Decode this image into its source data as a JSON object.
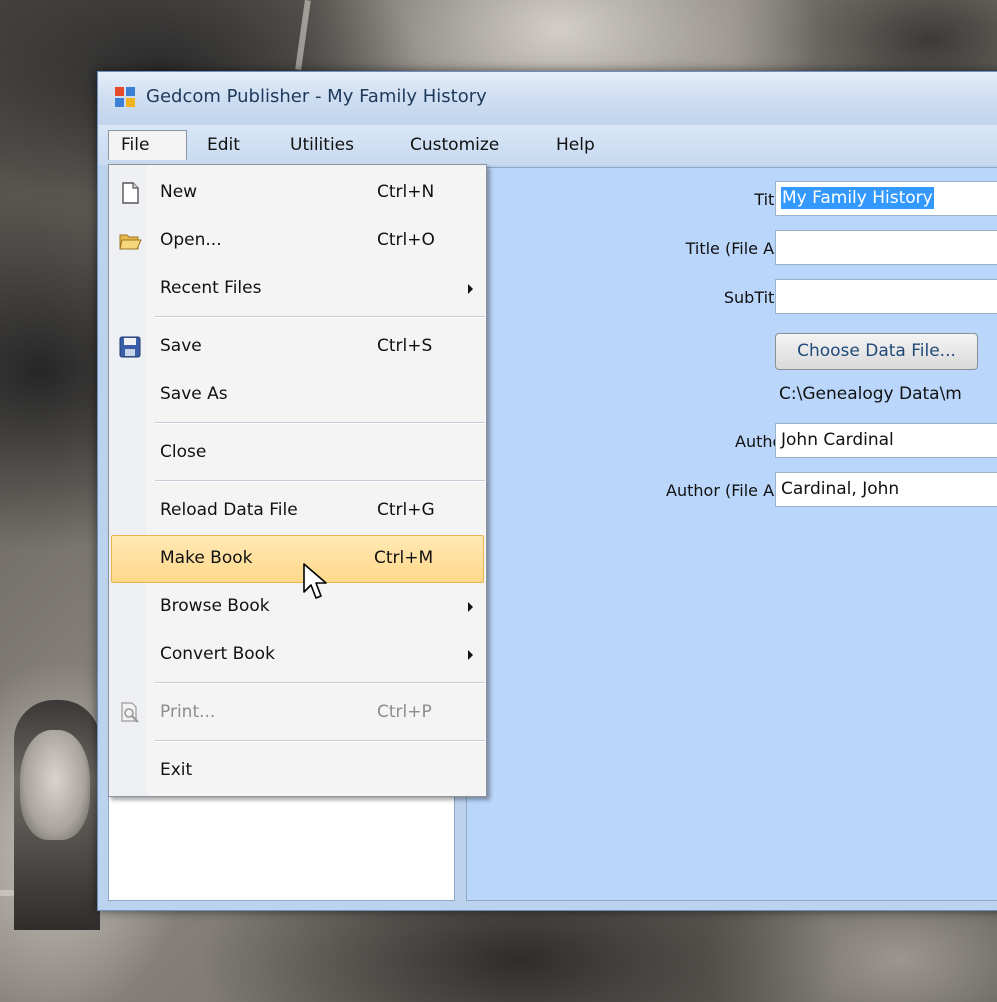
{
  "window": {
    "title": "Gedcom Publisher - My Family History"
  },
  "menubar": {
    "items": [
      {
        "label": "File"
      },
      {
        "label": "Edit"
      },
      {
        "label": "Utilities"
      },
      {
        "label": "Customize"
      },
      {
        "label": "Help"
      }
    ]
  },
  "file_menu": {
    "items": [
      {
        "label": "New",
        "shortcut": "Ctrl+N",
        "icon": "new-document-icon"
      },
      {
        "label": "Open...",
        "shortcut": "Ctrl+O",
        "icon": "open-folder-icon"
      },
      {
        "label": "Recent Files",
        "shortcut": "",
        "submenu": true
      },
      {
        "label": "Save",
        "shortcut": "Ctrl+S",
        "icon": "save-disk-icon"
      },
      {
        "label": "Save As",
        "shortcut": ""
      },
      {
        "label": "Close",
        "shortcut": ""
      },
      {
        "label": "Reload Data File",
        "shortcut": "Ctrl+G"
      },
      {
        "label": "Make Book",
        "shortcut": "Ctrl+M",
        "highlighted": true
      },
      {
        "label": "Browse Book",
        "shortcut": "",
        "submenu": true
      },
      {
        "label": "Convert Book",
        "shortcut": "",
        "submenu": true
      },
      {
        "label": "Print...",
        "shortcut": "Ctrl+P",
        "icon": "print-preview-icon",
        "disabled": true
      },
      {
        "label": "Exit",
        "shortcut": ""
      }
    ]
  },
  "form": {
    "title_label": "Title:",
    "title_value": "My Family History",
    "title_file_as_label": "Title (File As):",
    "title_file_as_value": "",
    "subtitle_label": "SubTitle:",
    "subtitle_value": "",
    "choose_button": "Choose Data File...",
    "data_file_path": "C:\\Genealogy Data\\m",
    "author_label": "Author:",
    "author_value": "John Cardinal",
    "author_file_as_label": "Author (File As):",
    "author_file_as_value": "Cardinal, John"
  },
  "colors": {
    "accent": "#3399ff",
    "window_bg": "#bcd3ee",
    "panel_bg": "#bad6fb",
    "menu_highlight": "#ffd88a"
  }
}
